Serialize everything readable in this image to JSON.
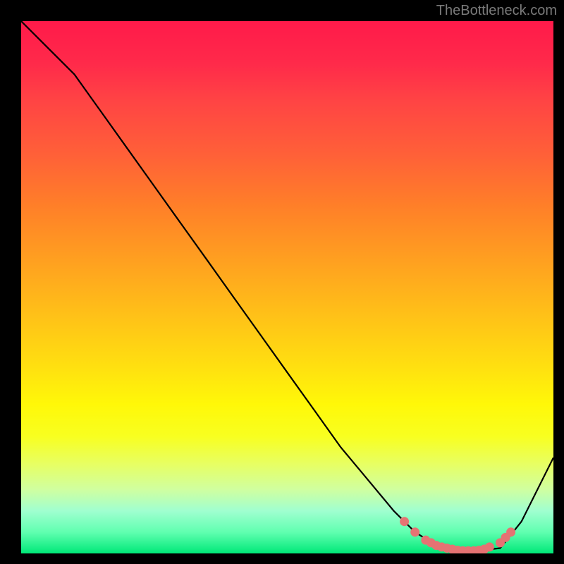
{
  "attribution": "TheBottleneck.com",
  "chart_data": {
    "type": "line",
    "title": "",
    "xlabel": "",
    "ylabel": "",
    "xlim": [
      0,
      100
    ],
    "ylim": [
      0,
      100
    ],
    "series": [
      {
        "name": "bottleneck-curve",
        "x": [
          0,
          5,
          10,
          15,
          20,
          25,
          30,
          35,
          40,
          45,
          50,
          55,
          60,
          65,
          70,
          74,
          78,
          82,
          86,
          90,
          94,
          100
        ],
        "y": [
          100,
          95,
          90,
          83,
          76,
          69,
          62,
          55,
          48,
          41,
          34,
          27,
          20,
          14,
          8,
          4,
          1.5,
          0.5,
          0.5,
          1,
          6,
          18
        ]
      }
    ],
    "optimal_points": {
      "name": "optimal-range-dots",
      "x": [
        72,
        74,
        76,
        77,
        78,
        79,
        80,
        81,
        82,
        83,
        84,
        85,
        86,
        87,
        88,
        90,
        91,
        92
      ],
      "y": [
        6,
        4,
        2.5,
        2,
        1.5,
        1.2,
        1,
        0.8,
        0.6,
        0.5,
        0.5,
        0.5,
        0.6,
        0.8,
        1.2,
        2,
        3,
        4
      ]
    },
    "gradient_meaning": "red-to-green vertical gradient indicating bottleneck severity (top=high, bottom=low)"
  }
}
